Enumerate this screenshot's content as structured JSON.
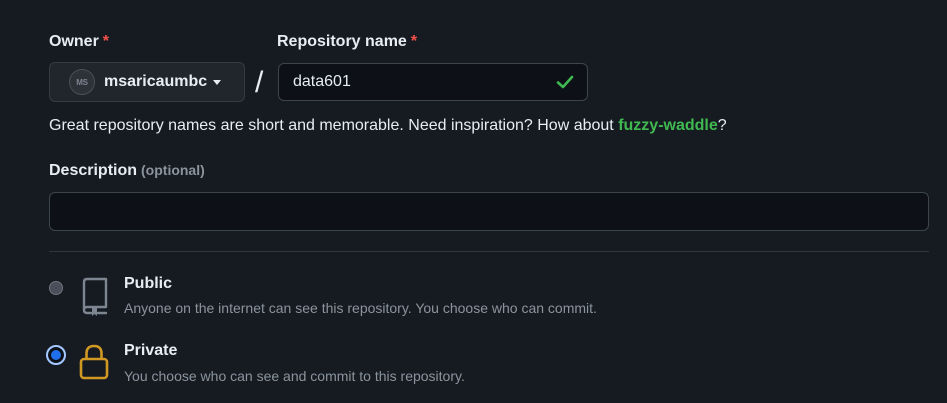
{
  "owner": {
    "label": "Owner",
    "required_mark": "*",
    "avatar_text": "MS",
    "selected": "msaricaumbc"
  },
  "separator": "/",
  "repository": {
    "label": "Repository name",
    "required_mark": "*",
    "value": "data601"
  },
  "hint": {
    "prefix": "Great repository names are short and memorable. Need inspiration? How about ",
    "suggestion": "fuzzy-waddle",
    "suffix": "?"
  },
  "description": {
    "label": "Description",
    "optional": "(optional)",
    "value": ""
  },
  "visibility": {
    "options": [
      {
        "title": "Public",
        "description": "Anyone on the internet can see this repository. You choose who can commit.",
        "icon": "repo-icon",
        "selected": false
      },
      {
        "title": "Private",
        "description": "You choose who can see and commit to this repository.",
        "icon": "lock-icon",
        "selected": true
      }
    ]
  },
  "colors": {
    "background": "#161b22",
    "input_bg": "#0d1117",
    "success": "#3fb950",
    "required": "#f85149",
    "muted": "#8b949e",
    "lock": "#d29922"
  }
}
